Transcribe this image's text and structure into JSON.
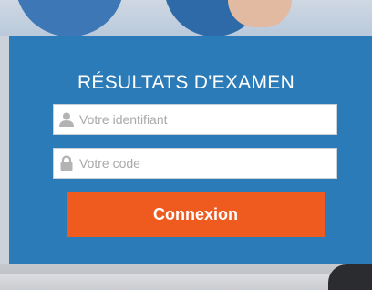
{
  "login": {
    "title": "RÉSULTATS D'EXAMEN",
    "identifier_placeholder": "Votre identifiant",
    "code_placeholder": "Votre code",
    "submit_label": "Connexion",
    "identifier_icon": "user-icon",
    "code_icon": "lock-icon"
  },
  "colors": {
    "panel": "#2b7bb8",
    "button": "#ef5a1f",
    "field_background": "#ffffff",
    "placeholder": "#a9a9a9"
  }
}
